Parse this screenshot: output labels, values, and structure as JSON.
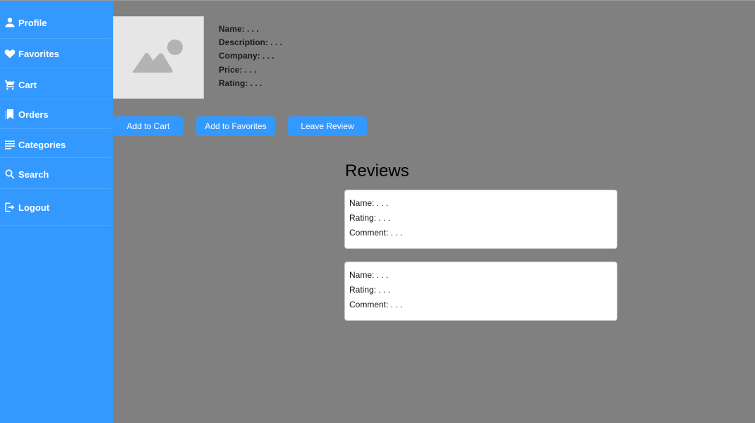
{
  "sidebar": {
    "items": [
      {
        "label": "Profile",
        "icon": "person-icon"
      },
      {
        "label": "Favorites",
        "icon": "heart-icon"
      },
      {
        "label": "Cart",
        "icon": "cart-icon"
      },
      {
        "label": "Orders",
        "icon": "bookmark-icon"
      },
      {
        "label": "Categories",
        "icon": "list-icon"
      },
      {
        "label": "Search",
        "icon": "search-icon"
      },
      {
        "label": "Logout",
        "icon": "logout-icon"
      }
    ]
  },
  "product": {
    "image": "image-placeholder-icon",
    "fields": {
      "name": "Name: . . .",
      "description": "Description: . . .",
      "company": "Company: . . .",
      "price": "Price: . . .",
      "rating": "Rating: . . ."
    }
  },
  "actions": {
    "add_to_cart": "Add to Cart",
    "add_to_favorites": "Add to Favorites",
    "leave_review": "Leave Review"
  },
  "reviews": {
    "title": "Reviews",
    "items": [
      {
        "name": "Name: . . .",
        "rating": "Rating: . . .",
        "comment": "Comment: . . ."
      },
      {
        "name": "Name: . . .",
        "rating": "Rating: . . .",
        "comment": "Comment: . . ."
      }
    ]
  },
  "colors": {
    "accent": "#3399ff",
    "background": "#808080",
    "card": "#ffffff"
  }
}
